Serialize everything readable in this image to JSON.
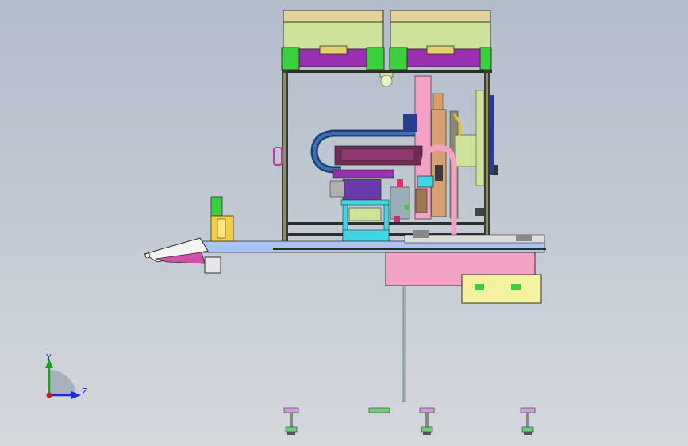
{
  "view": {
    "background_top": "#b3bcc9",
    "background_bottom": "#d4d8dd"
  },
  "triad": {
    "y_label": "Y",
    "z_label": "Z",
    "y_color": "#1aa51a",
    "z_color": "#1c2bd8",
    "x_color": "#d21a1a",
    "icons": [
      "coordinate-triad-icon"
    ]
  },
  "colors": {
    "hopper": "#cfe29a",
    "hopper_cap": "#e3d29e",
    "purple": "#9a2fb0",
    "green": "#3ccf3c",
    "pink": "#f3a2c6",
    "cyan": "#3fd6e6",
    "frame": "#2d2d2d",
    "conveyor": "#a9c4f2",
    "yellow": "#f2f2a0",
    "navy": "#2a3d8c"
  }
}
